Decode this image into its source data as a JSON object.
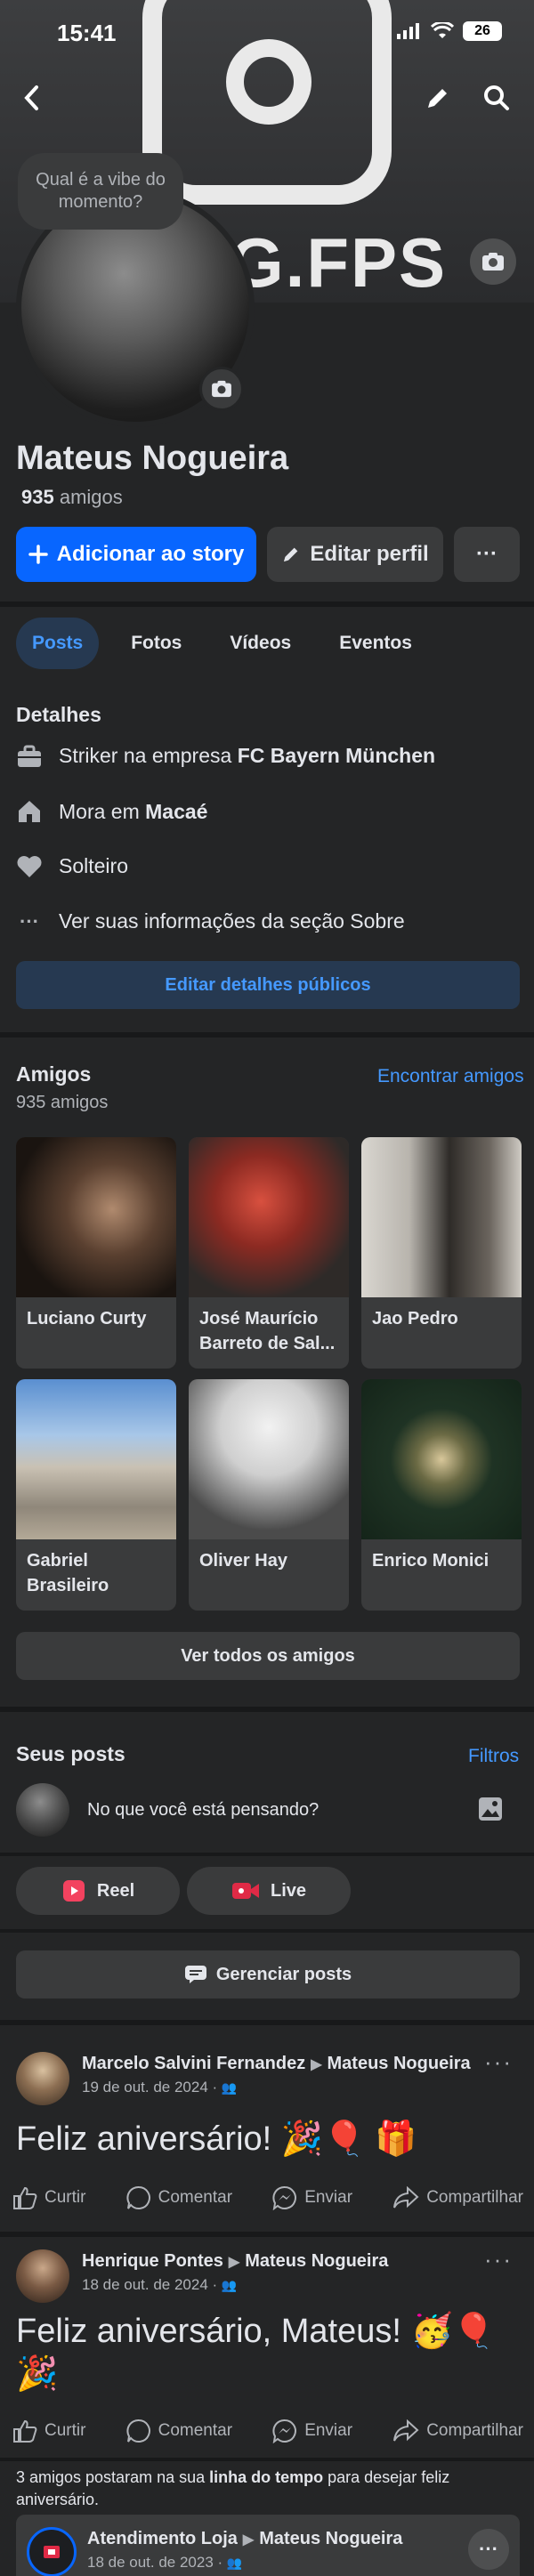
{
  "status_bar": {
    "time": "15:41",
    "battery": "26"
  },
  "cover": {
    "text": "G.FPS"
  },
  "tooltip": "Qual é a vibe do momento?",
  "profile": {
    "name": "Mateus Nogueira",
    "friends_count": "935",
    "friends_word": "amigos"
  },
  "buttons": {
    "add_story": "Adicionar ao story",
    "edit_profile": "Editar perfil",
    "more": "···"
  },
  "tabs": [
    "Posts",
    "Fotos",
    "Vídeos",
    "Eventos"
  ],
  "details": {
    "title": "Detalhes",
    "work_prefix": "Striker na empresa ",
    "work_company": "FC Bayern München",
    "home_prefix": "Mora em ",
    "home_city": "Macaé",
    "relationship": "Solteiro",
    "about": "Ver suas informações da seção Sobre",
    "edit_button": "Editar detalhes públicos"
  },
  "friends": {
    "title": "Amigos",
    "count": "935 amigos",
    "find_link": "Encontrar amigos",
    "items": [
      {
        "name": "Luciano Curty"
      },
      {
        "name": "José Maurício Barreto de Sal..."
      },
      {
        "name": "Jao Pedro"
      },
      {
        "name": "Gabriel Brasileiro"
      },
      {
        "name": "Oliver Hay"
      },
      {
        "name": "Enrico Monici"
      }
    ],
    "see_all": "Ver todos os amigos"
  },
  "my_posts": {
    "title": "Seus posts",
    "filters": "Filtros",
    "composer_placeholder": "No que você está pensando?",
    "reel": "Reel",
    "live": "Live",
    "manage": "Gerenciar posts"
  },
  "posts": [
    {
      "author": "Marcelo Salvini Fernandez",
      "target": "Mateus Nogueira",
      "date": "19 de out. de 2024 ·",
      "text": "Feliz aniversário! 🎉🎈 🎁"
    },
    {
      "author": "Henrique Pontes",
      "target": "Mateus Nogueira",
      "date": "18 de out. de 2024 ·",
      "text": "Feliz aniversário, Mateus! 🥳🎈 🎉"
    }
  ],
  "post_actions": {
    "like": "Curtir",
    "comment": "Comentar",
    "send": "Enviar",
    "share": "Compartilhar"
  },
  "timeline_note": {
    "prefix": "3 amigos postaram na sua ",
    "bold": "linha do tempo",
    "suffix": " para desejar feliz aniversário."
  },
  "last_post": {
    "author": "Atendimento Loja",
    "target": "Mateus Nogueira",
    "date": "18 de out. de 2023 ·"
  }
}
